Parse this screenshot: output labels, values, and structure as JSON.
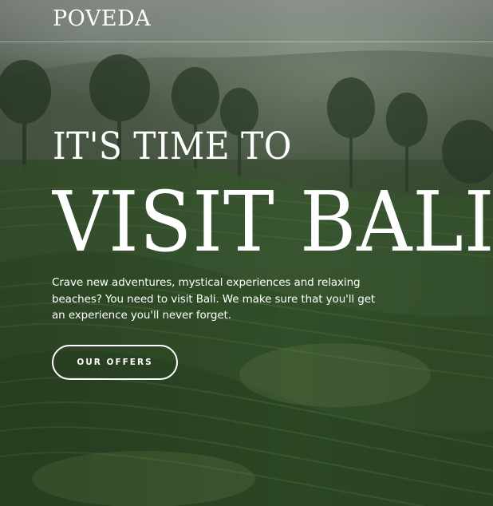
{
  "brand": {
    "logo_text": "POVEDA"
  },
  "hero": {
    "kicker": "IT'S TIME TO",
    "headline": "VISIT BALI",
    "description": "Crave new adventures, mystical experiences and relaxing beaches? You need to visit Bali. We make sure that you'll get an experience you'll never forget.",
    "cta_label": "OUR OFFERS",
    "background": "misty-tea-plantation-hills"
  },
  "colors": {
    "text": "#ffffff",
    "foliage_dark": "#263f21",
    "foliage_mid": "#35502c",
    "mist": "#8d958c"
  }
}
